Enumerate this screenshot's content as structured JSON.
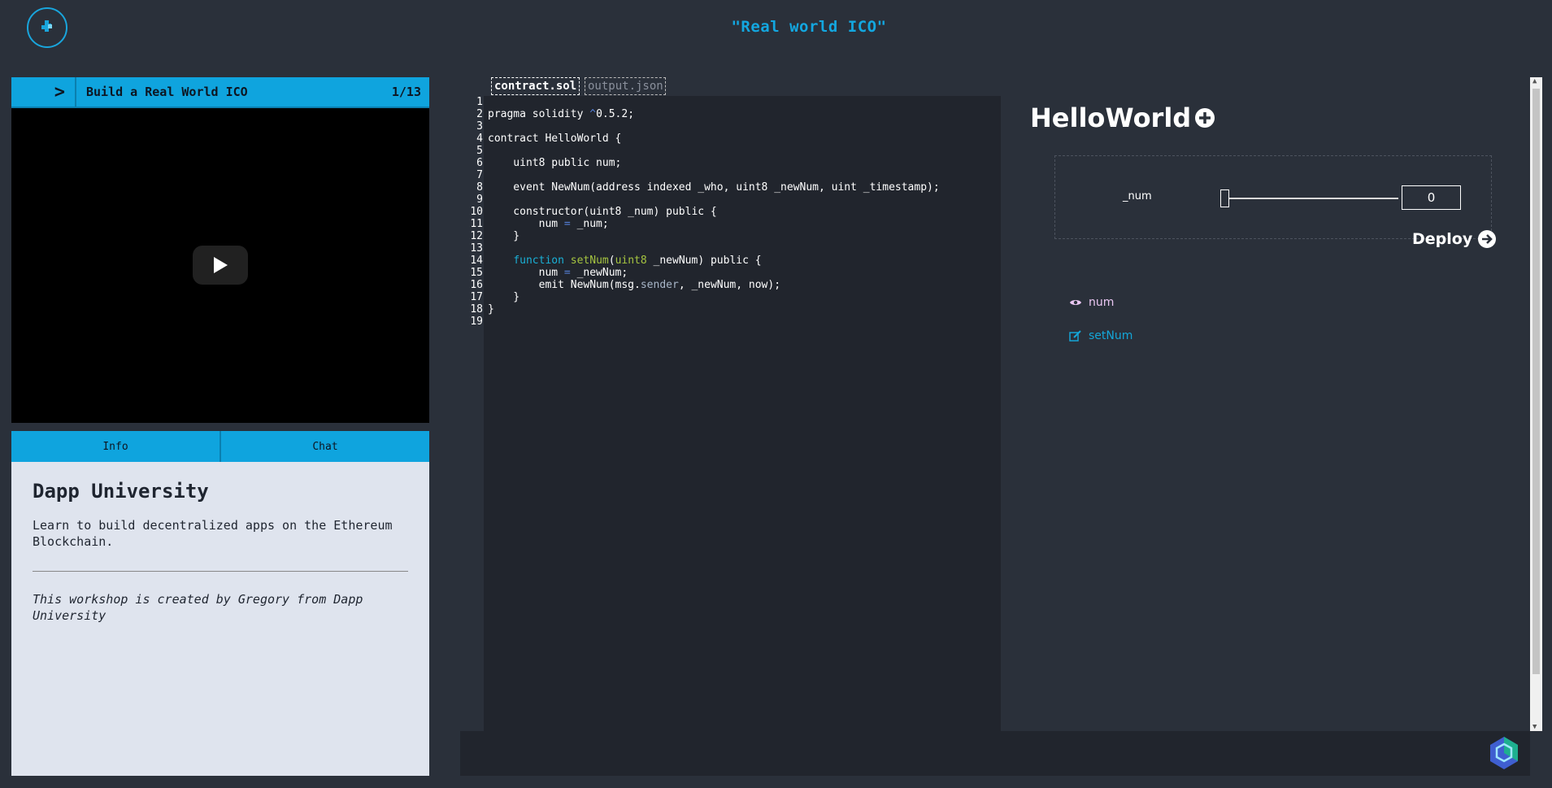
{
  "header": {
    "title": "\"Real world ICO\""
  },
  "icons": {
    "logo": "puzzle-logo-icon",
    "expand": "chevron-right-icon",
    "play": "play-icon",
    "add": "plus-circle-icon",
    "deploy": "arrow-circle-right-icon",
    "view": "eye-icon",
    "edit": "edit-icon",
    "badge": "hexagon-badge-icon"
  },
  "colors": {
    "accent": "#0fa4de",
    "background": "#2a303a",
    "editor_bg": "#21252d",
    "info_bg": "#dfe4ee"
  },
  "video": {
    "expand_label": ">",
    "title": "Build a Real World ICO",
    "step": "1/13"
  },
  "tabs": [
    {
      "label": "Info"
    },
    {
      "label": "Chat"
    }
  ],
  "info": {
    "heading": "Dapp University",
    "description": "Learn to build decentralized apps on the Ethereum Blockchain.",
    "credit": "This workshop is created by Gregory from Dapp University"
  },
  "editor": {
    "tabs": [
      {
        "label": "contract.sol",
        "active": true
      },
      {
        "label": "output.json",
        "active": false
      }
    ],
    "lines": [
      "",
      "pragma solidity ^0.5.2;",
      "",
      "contract HelloWorld {",
      "",
      "    uint8 public num;",
      "",
      "    event NewNum(address indexed _who, uint8 _newNum, uint _timestamp);",
      "",
      "    constructor(uint8 _num) public {",
      "        num = _num;",
      "    }",
      "",
      "    function setNum(uint8 _newNum) public {",
      "        num = _newNum;",
      "        emit NewNum(msg.sender, _newNum, now);",
      "    }",
      "}",
      ""
    ]
  },
  "contract": {
    "name": "HelloWorld",
    "param": {
      "label": "_num",
      "value": "0",
      "slider_value": 0
    },
    "deploy_label": "Deploy",
    "methods": [
      {
        "name": "num",
        "kind": "view"
      },
      {
        "name": "setNum",
        "kind": "write"
      }
    ]
  }
}
